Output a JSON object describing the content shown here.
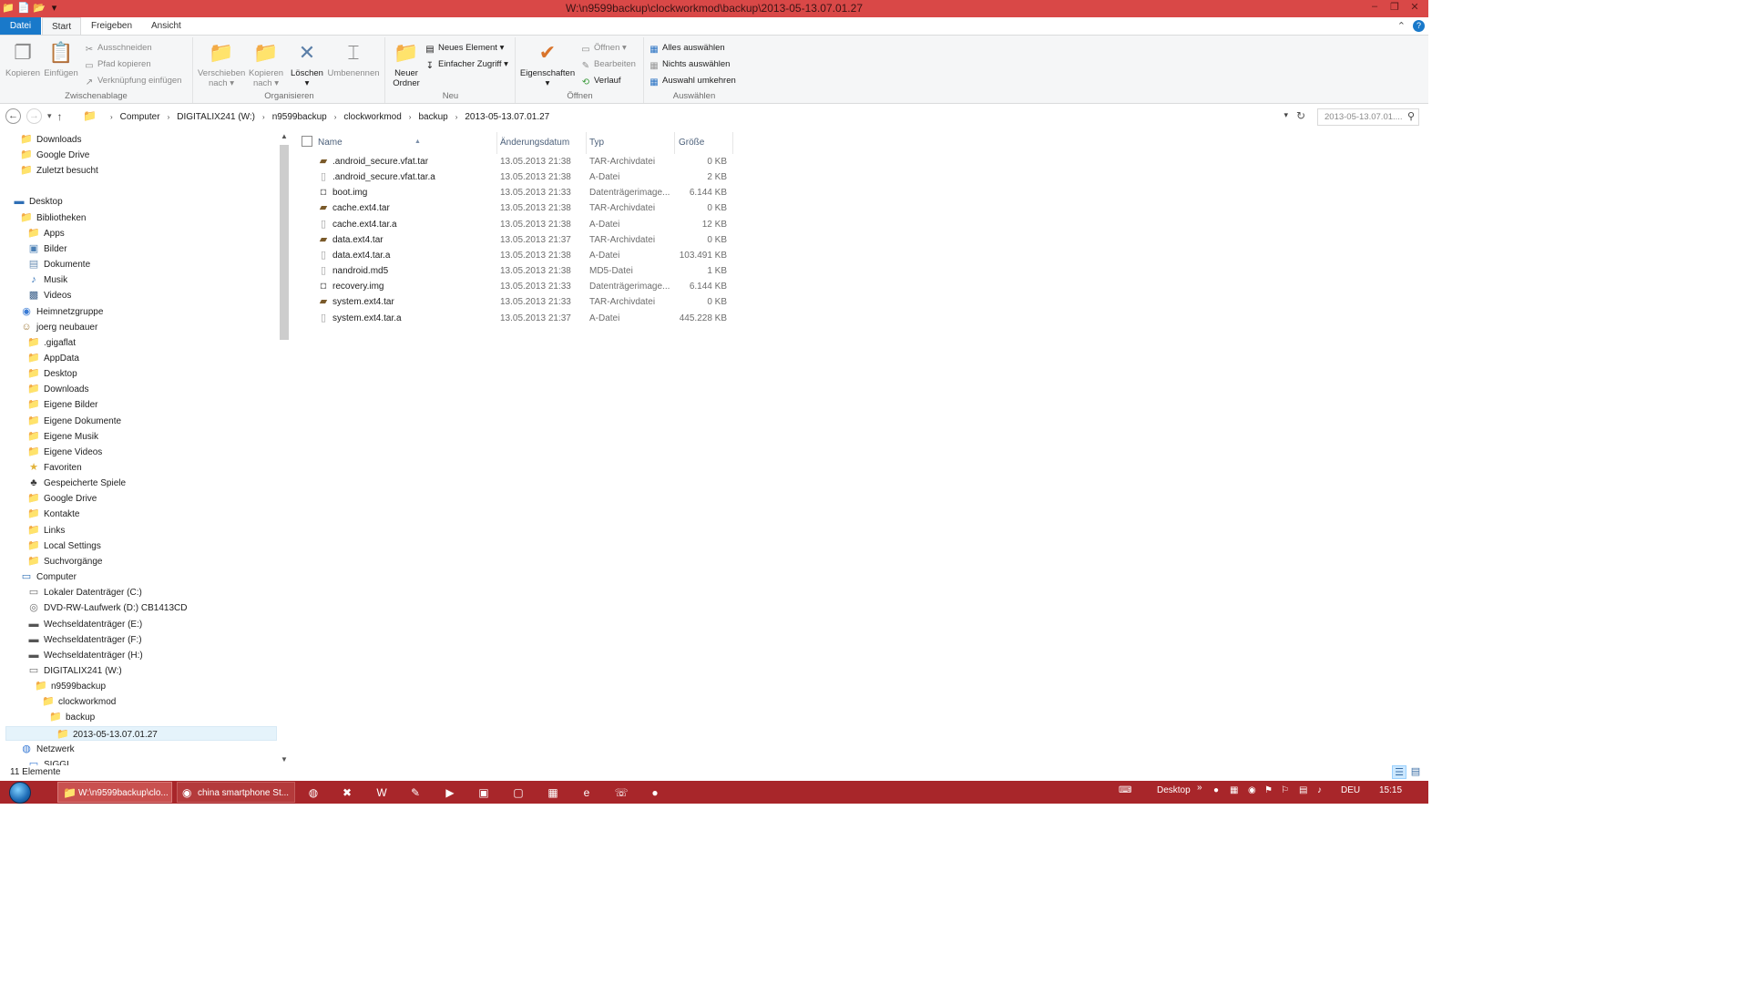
{
  "window": {
    "title": "W:\\n9599backup\\clockworkmod\\backup\\2013-05-13.07.01.27"
  },
  "ribbon_tabs": {
    "file": "Datei",
    "start": "Start",
    "share": "Freigeben",
    "view": "Ansicht"
  },
  "ribbon": {
    "clipboard": {
      "title": "Zwischenablage",
      "copy": "Kopieren",
      "paste": "Einfügen",
      "cut": "Ausschneiden",
      "copy_path": "Pfad kopieren",
      "paste_shortcut": "Verknüpfung einfügen"
    },
    "organize": {
      "title": "Organisieren",
      "move_to": "Verschieben",
      "move_to_2": "nach",
      "copy_to": "Kopieren",
      "copy_to_2": "nach",
      "delete": "Löschen",
      "rename": "Umbenennen"
    },
    "new": {
      "title": "Neu",
      "new_folder": "Neuer",
      "new_folder_2": "Ordner",
      "new_item": "Neues Element",
      "easy_access": "Einfacher Zugriff"
    },
    "open": {
      "title": "Öffnen",
      "properties": "Eigenschaften",
      "open": "Öffnen",
      "edit": "Bearbeiten",
      "history": "Verlauf"
    },
    "select": {
      "title": "Auswählen",
      "select_all": "Alles auswählen",
      "select_none": "Nichts auswählen",
      "invert": "Auswahl umkehren"
    }
  },
  "address": {
    "crumbs": [
      "Computer",
      "DIGITALIX241 (W:)",
      "n9599backup",
      "clockworkmod",
      "backup",
      "2013-05-13.07.01.27"
    ],
    "search_placeholder": "2013-05-13.07.01...."
  },
  "navpane": {
    "items": [
      {
        "label": "Downloads",
        "icon": "downloads-folder-icon",
        "level": 1
      },
      {
        "label": "Google Drive",
        "icon": "google-drive-folder-icon",
        "level": 1
      },
      {
        "label": "Zuletzt besucht",
        "icon": "recent-places-icon",
        "level": 1
      },
      {
        "label": "Desktop",
        "icon": "desktop-icon",
        "level": 0
      },
      {
        "label": "Bibliotheken",
        "icon": "libraries-icon",
        "level": 1
      },
      {
        "label": "Apps",
        "icon": "folder-icon",
        "level": 2
      },
      {
        "label": "Bilder",
        "icon": "pictures-library-icon",
        "level": 2
      },
      {
        "label": "Dokumente",
        "icon": "documents-library-icon",
        "level": 2
      },
      {
        "label": "Musik",
        "icon": "music-library-icon",
        "level": 2
      },
      {
        "label": "Videos",
        "icon": "videos-library-icon",
        "level": 2
      },
      {
        "label": "Heimnetzgruppe",
        "icon": "homegroup-icon",
        "level": 1
      },
      {
        "label": "joerg neubauer",
        "icon": "user-icon",
        "level": 1
      },
      {
        "label": ".gigaflat",
        "icon": "folder-icon",
        "level": 2
      },
      {
        "label": "AppData",
        "icon": "folder-icon",
        "level": 2
      },
      {
        "label": "Desktop",
        "icon": "folder-icon",
        "level": 2
      },
      {
        "label": "Downloads",
        "icon": "downloads-folder-icon",
        "level": 2
      },
      {
        "label": "Eigene Bilder",
        "icon": "folder-icon",
        "level": 2
      },
      {
        "label": "Eigene Dokumente",
        "icon": "folder-icon",
        "level": 2
      },
      {
        "label": "Eigene Musik",
        "icon": "folder-icon",
        "level": 2
      },
      {
        "label": "Eigene Videos",
        "icon": "folder-icon",
        "level": 2
      },
      {
        "label": "Favoriten",
        "icon": "favorites-folder-icon",
        "level": 2
      },
      {
        "label": "Gespeicherte Spiele",
        "icon": "saved-games-icon",
        "level": 2
      },
      {
        "label": "Google Drive",
        "icon": "google-drive-folder-icon",
        "level": 2
      },
      {
        "label": "Kontakte",
        "icon": "contacts-folder-icon",
        "level": 2
      },
      {
        "label": "Links",
        "icon": "links-folder-icon",
        "level": 2
      },
      {
        "label": "Local Settings",
        "icon": "folder-icon",
        "level": 2
      },
      {
        "label": "Suchvorgänge",
        "icon": "searches-folder-icon",
        "level": 2
      },
      {
        "label": "Computer",
        "icon": "computer-icon",
        "level": 1
      },
      {
        "label": "Lokaler Datenträger (C:)",
        "icon": "drive-icon",
        "level": 2
      },
      {
        "label": "DVD-RW-Laufwerk (D:) CB1413CD",
        "icon": "dvd-drive-icon",
        "level": 2
      },
      {
        "label": "Wechseldatenträger (E:)",
        "icon": "removable-drive-icon",
        "level": 2
      },
      {
        "label": "Wechseldatenträger (F:)",
        "icon": "removable-drive-icon",
        "level": 2
      },
      {
        "label": "Wechseldatenträger (H:)",
        "icon": "removable-drive-icon",
        "level": 2
      },
      {
        "label": "DIGITALIX241 (W:)",
        "icon": "drive-icon",
        "level": 2
      },
      {
        "label": "n9599backup",
        "icon": "folder-icon",
        "level": 3
      },
      {
        "label": "clockworkmod",
        "icon": "folder-icon",
        "level": 4
      },
      {
        "label": "backup",
        "icon": "folder-icon",
        "level": 5
      },
      {
        "label": "2013-05-13.07.01.27",
        "icon": "folder-icon",
        "level": 6,
        "selected": true
      },
      {
        "label": "Netzwerk",
        "icon": "network-icon",
        "level": 1
      },
      {
        "label": "SIGGI",
        "icon": "network-computer-icon",
        "level": 2
      }
    ]
  },
  "filelist": {
    "columns": {
      "name": "Name",
      "date": "Änderungsdatum",
      "type": "Typ",
      "size": "Größe"
    },
    "rows": [
      {
        "name": ".android_secure.vfat.tar",
        "date": "13.05.2013 21:38",
        "type": "TAR-Archivdatei",
        "size": "0 KB",
        "icon": "archive-icon"
      },
      {
        "name": ".android_secure.vfat.tar.a",
        "date": "13.05.2013 21:38",
        "type": "A-Datei",
        "size": "2 KB",
        "icon": "file-icon"
      },
      {
        "name": "boot.img",
        "date": "13.05.2013 21:33",
        "type": "Datenträgerimage...",
        "size": "6.144 KB",
        "icon": "disc-image-icon"
      },
      {
        "name": "cache.ext4.tar",
        "date": "13.05.2013 21:38",
        "type": "TAR-Archivdatei",
        "size": "0 KB",
        "icon": "archive-icon"
      },
      {
        "name": "cache.ext4.tar.a",
        "date": "13.05.2013 21:38",
        "type": "A-Datei",
        "size": "12 KB",
        "icon": "file-icon"
      },
      {
        "name": "data.ext4.tar",
        "date": "13.05.2013 21:37",
        "type": "TAR-Archivdatei",
        "size": "0 KB",
        "icon": "archive-icon"
      },
      {
        "name": "data.ext4.tar.a",
        "date": "13.05.2013 21:38",
        "type": "A-Datei",
        "size": "103.491 KB",
        "icon": "file-icon"
      },
      {
        "name": "nandroid.md5",
        "date": "13.05.2013 21:38",
        "type": "MD5-Datei",
        "size": "1 KB",
        "icon": "file-icon"
      },
      {
        "name": "recovery.img",
        "date": "13.05.2013 21:33",
        "type": "Datenträgerimage...",
        "size": "6.144 KB",
        "icon": "disc-image-icon"
      },
      {
        "name": "system.ext4.tar",
        "date": "13.05.2013 21:33",
        "type": "TAR-Archivdatei",
        "size": "0 KB",
        "icon": "archive-icon"
      },
      {
        "name": "system.ext4.tar.a",
        "date": "13.05.2013 21:37",
        "type": "A-Datei",
        "size": "445.228 KB",
        "icon": "file-icon"
      }
    ]
  },
  "status": {
    "count": "11 Elemente"
  },
  "taskbar": {
    "explorer_label": "W:\\n9599backup\\clo...",
    "chrome_label": "china smartphone St...",
    "desktop_label": "Desktop",
    "language": "DEU",
    "time": "15:15"
  },
  "colors": {
    "titlebar": "#d94847",
    "taskbar": "#a8262a",
    "accent": "#1979ca"
  }
}
